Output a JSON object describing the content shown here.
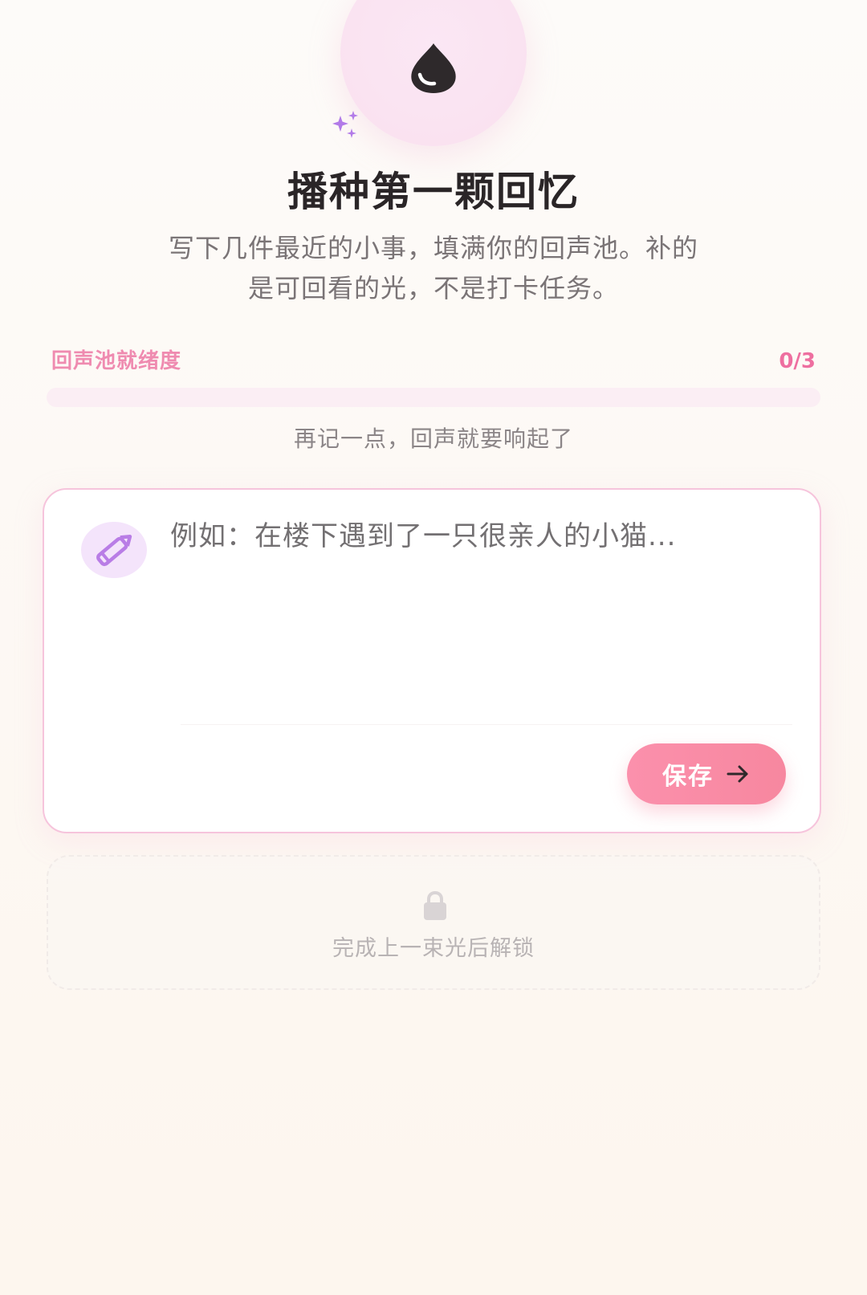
{
  "hero": {
    "icon": "water-drop-icon",
    "decoration_icon": "sparkle-icon",
    "title": "播种第一颗回忆",
    "subtitle_line1": "写下几件最近的小事，填满你的回声池。补的",
    "subtitle_line2": "是可回看的光，不是打卡任务。"
  },
  "progress": {
    "label": "回声池就绪度",
    "count_text": "0/3",
    "value": 0,
    "total": 3,
    "hint": "再记一点，回声就要响起了"
  },
  "input_card": {
    "icon": "pencil-icon",
    "value": "",
    "placeholder": "例如：在楼下遇到了一只很亲人的小猫...",
    "save_label": "保存",
    "save_icon": "arrow-right-icon"
  },
  "locked_card": {
    "icon": "lock-icon",
    "label": "完成上一束光后解锁"
  },
  "colors": {
    "accent_pink": "#ee6fa0",
    "button_pink": "#fb90ac",
    "pencil_purple": "#b97de6",
    "sparkle_purple": "#b27be8"
  }
}
